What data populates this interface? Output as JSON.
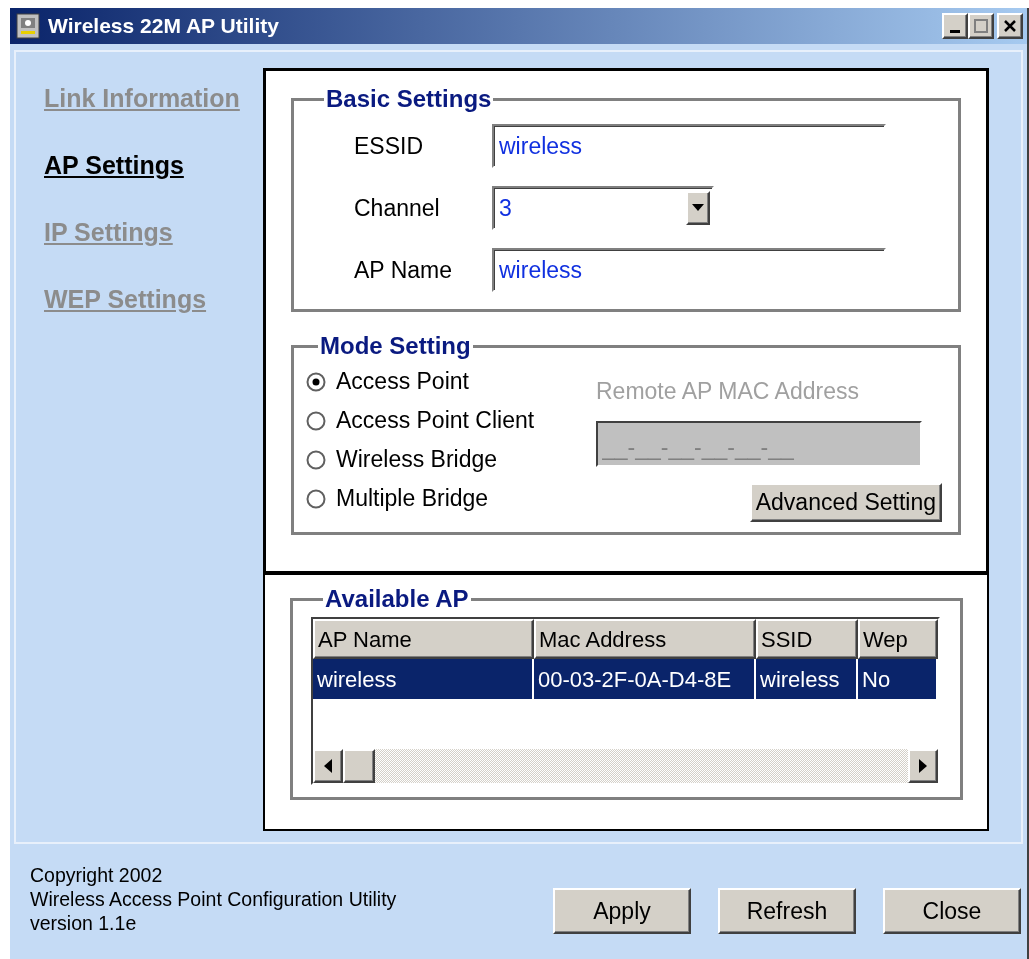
{
  "window": {
    "title": "Wireless 22M AP Utility"
  },
  "sidebar": {
    "items": [
      {
        "label": "Link Information",
        "selected": false
      },
      {
        "label": "AP Settings",
        "selected": true
      },
      {
        "label": "IP Settings",
        "selected": false
      },
      {
        "label": "WEP Settings",
        "selected": false
      }
    ]
  },
  "basic_settings": {
    "title": "Basic Settings",
    "fields": [
      {
        "kind": "text",
        "label": "ESSID",
        "value": "wireless"
      },
      {
        "kind": "dropdown",
        "label": "Channel",
        "value": "3"
      },
      {
        "kind": "text",
        "label": "AP Name",
        "value": "wireless"
      }
    ]
  },
  "mode_setting": {
    "title": "Mode Setting",
    "options": [
      {
        "label": "Access Point",
        "selected": true
      },
      {
        "label": "Access Point Client",
        "selected": false
      },
      {
        "label": "Wireless Bridge",
        "selected": false
      },
      {
        "label": "Multiple Bridge",
        "selected": false
      }
    ],
    "remote_mac": {
      "label": "Remote AP MAC Address",
      "placeholder": "__-__-__-__-__-__",
      "disabled": true
    },
    "button": "Advanced Setting"
  },
  "available_ap": {
    "title": "Available AP",
    "columns": [
      "AP Name",
      "Mac Address",
      "SSID",
      "Wep"
    ],
    "rows": [
      {
        "cells": [
          "wireless",
          "00-03-2F-0A-D4-8E",
          "wireless",
          "No"
        ],
        "selected": true
      }
    ]
  },
  "footer": {
    "lines": [
      "Copyright 2002",
      "Wireless Access Point Configuration Utility",
      "version 1.1e"
    ],
    "buttons": [
      "Apply",
      "Refresh",
      "Close"
    ]
  }
}
